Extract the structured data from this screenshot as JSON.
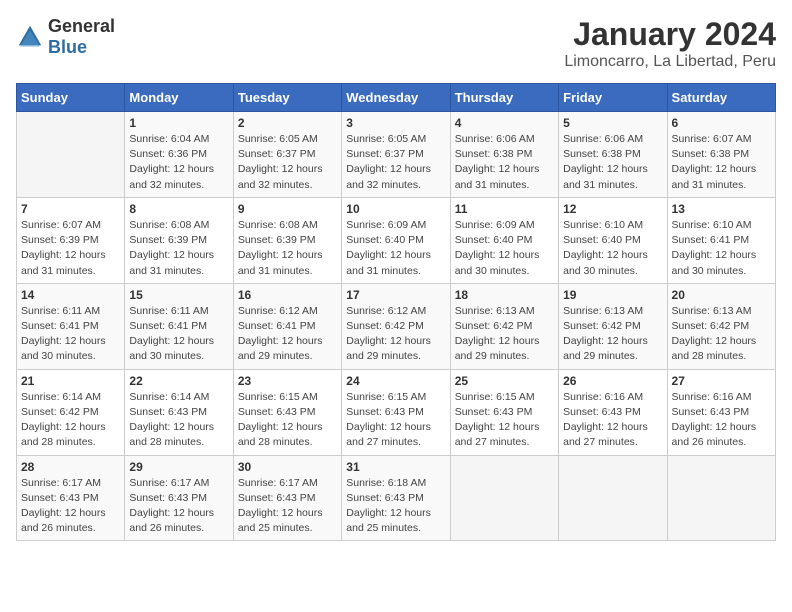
{
  "header": {
    "logo_general": "General",
    "logo_blue": "Blue",
    "title": "January 2024",
    "subtitle": "Limoncarro, La Libertad, Peru"
  },
  "calendar": {
    "days_of_week": [
      "Sunday",
      "Monday",
      "Tuesday",
      "Wednesday",
      "Thursday",
      "Friday",
      "Saturday"
    ],
    "weeks": [
      [
        {
          "day": "",
          "sunrise": "",
          "sunset": "",
          "daylight": ""
        },
        {
          "day": "1",
          "sunrise": "6:04 AM",
          "sunset": "6:36 PM",
          "daylight": "12 hours and 32 minutes."
        },
        {
          "day": "2",
          "sunrise": "6:05 AM",
          "sunset": "6:37 PM",
          "daylight": "12 hours and 32 minutes."
        },
        {
          "day": "3",
          "sunrise": "6:05 AM",
          "sunset": "6:37 PM",
          "daylight": "12 hours and 32 minutes."
        },
        {
          "day": "4",
          "sunrise": "6:06 AM",
          "sunset": "6:38 PM",
          "daylight": "12 hours and 31 minutes."
        },
        {
          "day": "5",
          "sunrise": "6:06 AM",
          "sunset": "6:38 PM",
          "daylight": "12 hours and 31 minutes."
        },
        {
          "day": "6",
          "sunrise": "6:07 AM",
          "sunset": "6:38 PM",
          "daylight": "12 hours and 31 minutes."
        }
      ],
      [
        {
          "day": "7",
          "sunrise": "6:07 AM",
          "sunset": "6:39 PM",
          "daylight": "12 hours and 31 minutes."
        },
        {
          "day": "8",
          "sunrise": "6:08 AM",
          "sunset": "6:39 PM",
          "daylight": "12 hours and 31 minutes."
        },
        {
          "day": "9",
          "sunrise": "6:08 AM",
          "sunset": "6:39 PM",
          "daylight": "12 hours and 31 minutes."
        },
        {
          "day": "10",
          "sunrise": "6:09 AM",
          "sunset": "6:40 PM",
          "daylight": "12 hours and 31 minutes."
        },
        {
          "day": "11",
          "sunrise": "6:09 AM",
          "sunset": "6:40 PM",
          "daylight": "12 hours and 30 minutes."
        },
        {
          "day": "12",
          "sunrise": "6:10 AM",
          "sunset": "6:40 PM",
          "daylight": "12 hours and 30 minutes."
        },
        {
          "day": "13",
          "sunrise": "6:10 AM",
          "sunset": "6:41 PM",
          "daylight": "12 hours and 30 minutes."
        }
      ],
      [
        {
          "day": "14",
          "sunrise": "6:11 AM",
          "sunset": "6:41 PM",
          "daylight": "12 hours and 30 minutes."
        },
        {
          "day": "15",
          "sunrise": "6:11 AM",
          "sunset": "6:41 PM",
          "daylight": "12 hours and 30 minutes."
        },
        {
          "day": "16",
          "sunrise": "6:12 AM",
          "sunset": "6:41 PM",
          "daylight": "12 hours and 29 minutes."
        },
        {
          "day": "17",
          "sunrise": "6:12 AM",
          "sunset": "6:42 PM",
          "daylight": "12 hours and 29 minutes."
        },
        {
          "day": "18",
          "sunrise": "6:13 AM",
          "sunset": "6:42 PM",
          "daylight": "12 hours and 29 minutes."
        },
        {
          "day": "19",
          "sunrise": "6:13 AM",
          "sunset": "6:42 PM",
          "daylight": "12 hours and 29 minutes."
        },
        {
          "day": "20",
          "sunrise": "6:13 AM",
          "sunset": "6:42 PM",
          "daylight": "12 hours and 28 minutes."
        }
      ],
      [
        {
          "day": "21",
          "sunrise": "6:14 AM",
          "sunset": "6:42 PM",
          "daylight": "12 hours and 28 minutes."
        },
        {
          "day": "22",
          "sunrise": "6:14 AM",
          "sunset": "6:43 PM",
          "daylight": "12 hours and 28 minutes."
        },
        {
          "day": "23",
          "sunrise": "6:15 AM",
          "sunset": "6:43 PM",
          "daylight": "12 hours and 28 minutes."
        },
        {
          "day": "24",
          "sunrise": "6:15 AM",
          "sunset": "6:43 PM",
          "daylight": "12 hours and 27 minutes."
        },
        {
          "day": "25",
          "sunrise": "6:15 AM",
          "sunset": "6:43 PM",
          "daylight": "12 hours and 27 minutes."
        },
        {
          "day": "26",
          "sunrise": "6:16 AM",
          "sunset": "6:43 PM",
          "daylight": "12 hours and 27 minutes."
        },
        {
          "day": "27",
          "sunrise": "6:16 AM",
          "sunset": "6:43 PM",
          "daylight": "12 hours and 26 minutes."
        }
      ],
      [
        {
          "day": "28",
          "sunrise": "6:17 AM",
          "sunset": "6:43 PM",
          "daylight": "12 hours and 26 minutes."
        },
        {
          "day": "29",
          "sunrise": "6:17 AM",
          "sunset": "6:43 PM",
          "daylight": "12 hours and 26 minutes."
        },
        {
          "day": "30",
          "sunrise": "6:17 AM",
          "sunset": "6:43 PM",
          "daylight": "12 hours and 25 minutes."
        },
        {
          "day": "31",
          "sunrise": "6:18 AM",
          "sunset": "6:43 PM",
          "daylight": "12 hours and 25 minutes."
        },
        {
          "day": "",
          "sunrise": "",
          "sunset": "",
          "daylight": ""
        },
        {
          "day": "",
          "sunrise": "",
          "sunset": "",
          "daylight": ""
        },
        {
          "day": "",
          "sunrise": "",
          "sunset": "",
          "daylight": ""
        }
      ]
    ],
    "labels": {
      "sunrise": "Sunrise:",
      "sunset": "Sunset:",
      "daylight": "Daylight:"
    }
  }
}
